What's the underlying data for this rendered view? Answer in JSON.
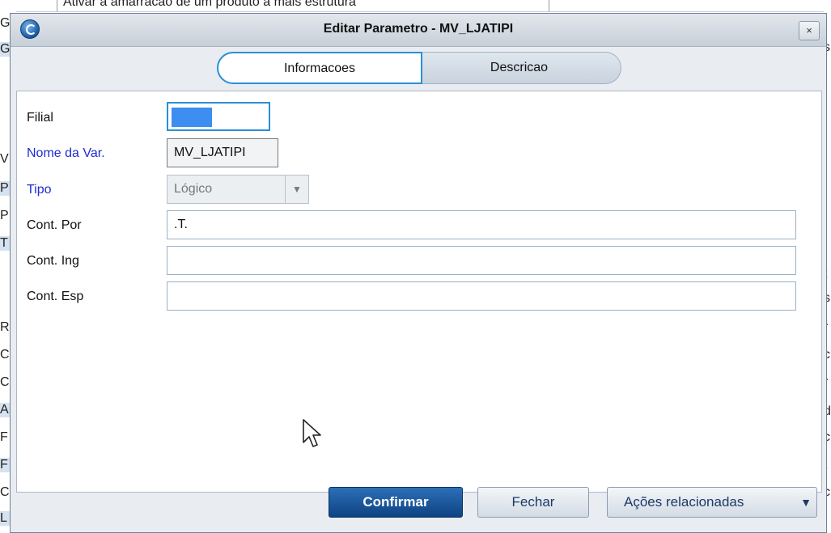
{
  "background": {
    "top_text": "Ativar a amarracao de um produto a mais estrutura",
    "left_fragments": [
      "G",
      "G",
      "V",
      "P",
      "P",
      "T",
      "R",
      "C",
      "C",
      "A",
      "F",
      "F",
      "C",
      "L"
    ],
    "right_fragments": [
      "s",
      "l",
      "t",
      "s",
      "r",
      "c",
      "r",
      "d",
      "c",
      "t",
      "c"
    ]
  },
  "dialog": {
    "title": "Editar Parametro - MV_LJATIPI",
    "close_label": "×",
    "tabs": [
      {
        "first": "I",
        "rest": "nformacoes",
        "active": true
      },
      {
        "first": "D",
        "rest": "escricao",
        "active": false
      }
    ],
    "form": {
      "filial_label": "Filial",
      "filial_value": "",
      "nome_label": "Nome da Var.",
      "nome_value": "MV_LJATIPI",
      "tipo_label": "Tipo",
      "tipo_value": "Lógico",
      "cont_por_label": "Cont. Por",
      "cont_por_value": ".T.",
      "cont_ing_label": "Cont. Ing",
      "cont_ing_value": "",
      "cont_esp_label": "Cont. Esp",
      "cont_esp_value": ""
    },
    "buttons": {
      "confirm": "Confirmar",
      "close": "Fechar",
      "actions": "Ações relacionadas"
    }
  },
  "colors": {
    "accent": "#2a8fd6",
    "primary_button": "#0d4382",
    "required_label": "#1f2bd6"
  }
}
